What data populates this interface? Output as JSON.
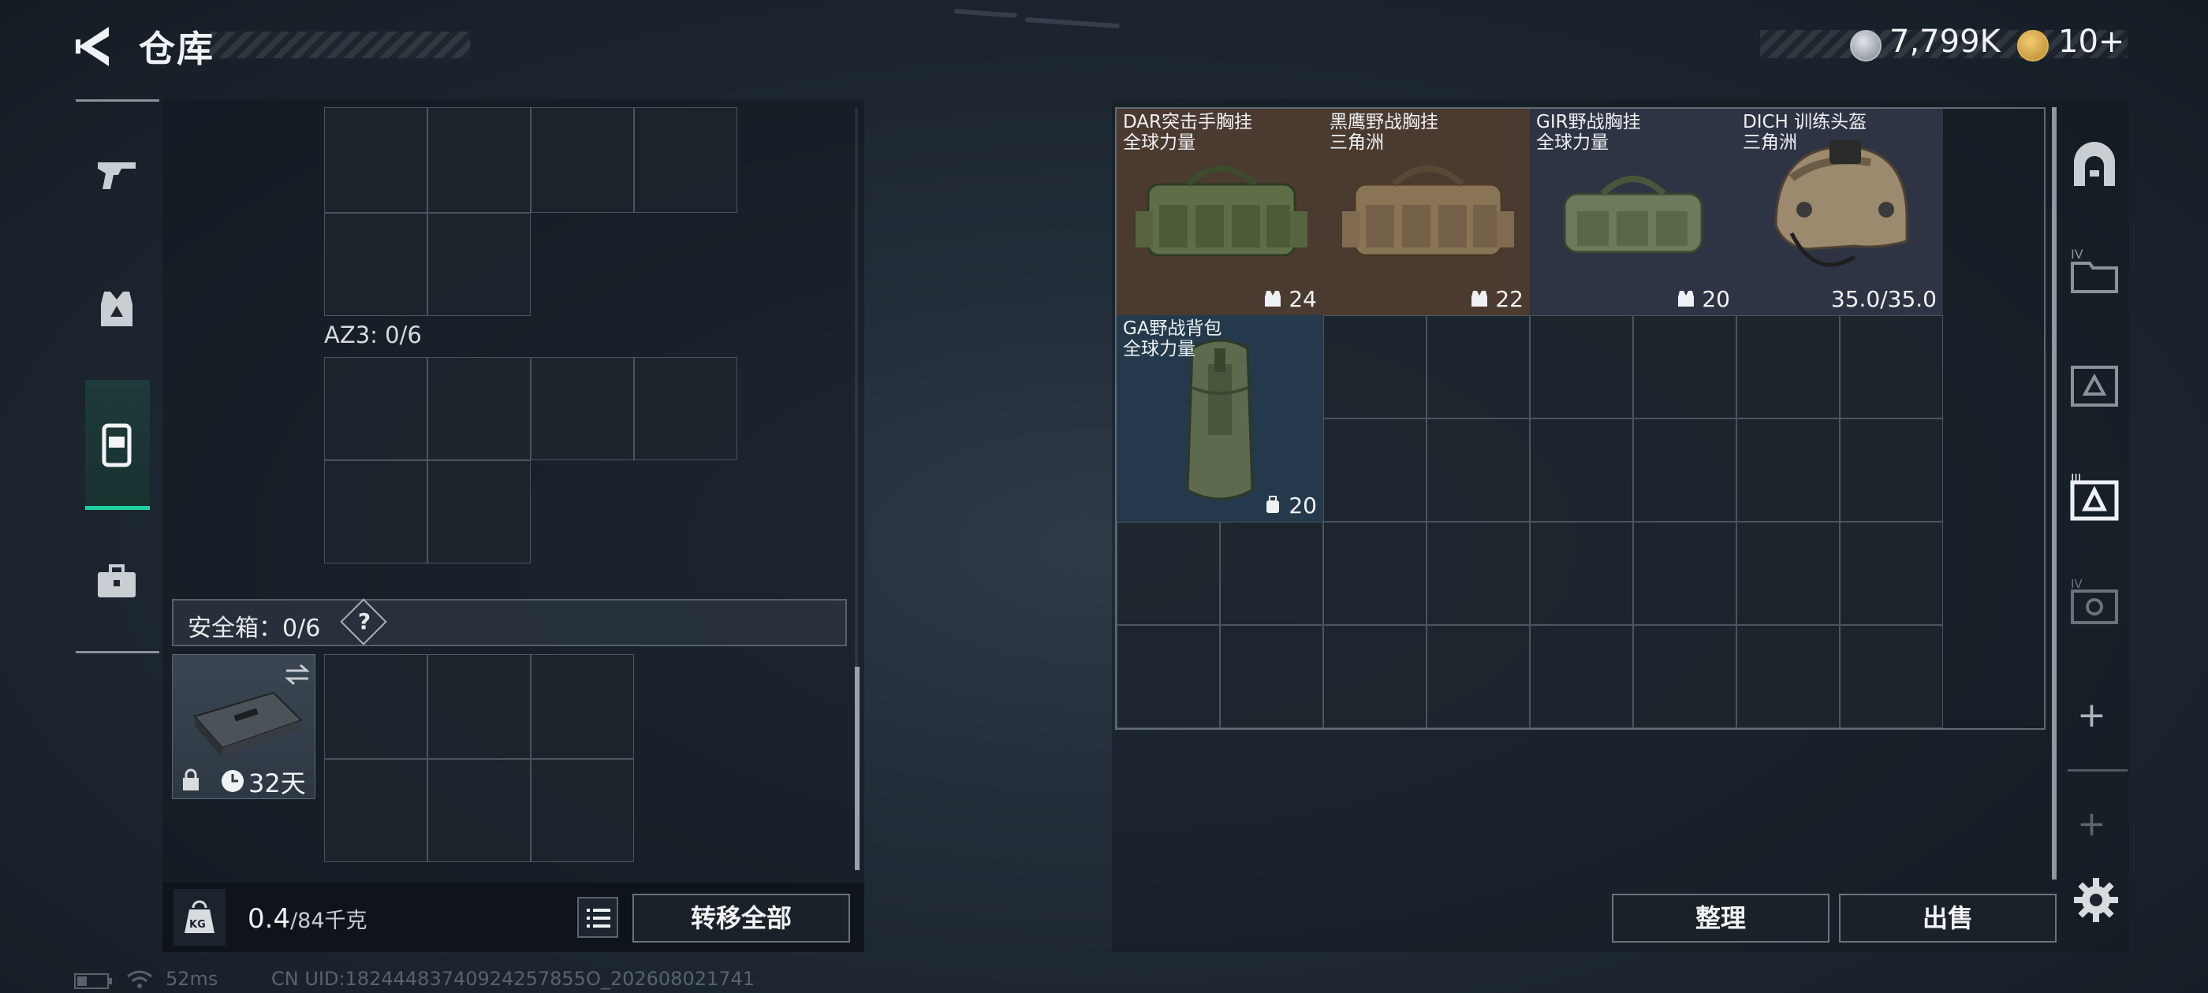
{
  "header": {
    "title": "仓库",
    "currency_1": "7,799K",
    "currency_2": "10+"
  },
  "left_sidebar": {
    "tabs": [
      {
        "icon": "pistol-icon",
        "active": false
      },
      {
        "icon": "vest-icon",
        "active": false
      },
      {
        "icon": "backpack-icon",
        "active": true
      },
      {
        "icon": "toolbox-icon",
        "active": false
      }
    ]
  },
  "storage": {
    "az3_label": "AZ3: 0/6",
    "safebox_label": "安全箱：0/6",
    "safebox_help": "?",
    "safebox_days": "32天"
  },
  "weight": {
    "current": "0.4",
    "max": "/84千克",
    "kg_icon_label": "KG"
  },
  "buttons": {
    "transfer_all": "转移全部",
    "sort": "整理",
    "sell": "出售"
  },
  "items": [
    {
      "name": "DAR突击手胸挂",
      "subtitle": "全球力量",
      "count": "24",
      "count_icon": "vest-mini-icon",
      "bg": "#4a3a30"
    },
    {
      "name": "黑鹰野战胸挂",
      "subtitle": "三角洲",
      "count": "22",
      "count_icon": "vest-mini-icon",
      "bg": "#4a3a30"
    },
    {
      "name": "GIR野战胸挂",
      "subtitle": "全球力量",
      "count": "20",
      "count_icon": "vest-mini-icon",
      "bg": "#2f3444"
    },
    {
      "name": "DICH 训练头盔",
      "subtitle": "三角洲",
      "count": "35.0/35.0",
      "count_icon": "",
      "bg": "#2f3444"
    },
    {
      "name": "GA野战背包",
      "subtitle": "全球力量",
      "count": "20",
      "count_icon": "backpack-mini-icon",
      "bg": "#243a4c"
    }
  ],
  "status_bar": {
    "ping": "52ms",
    "uid": "CN UID:18244483740924257855O_202608021741"
  },
  "colors": {
    "accent": "#20d0a0",
    "panel_border": "#606a74",
    "tile_brown": "#4a3a30",
    "tile_blue": "#243a4c"
  }
}
